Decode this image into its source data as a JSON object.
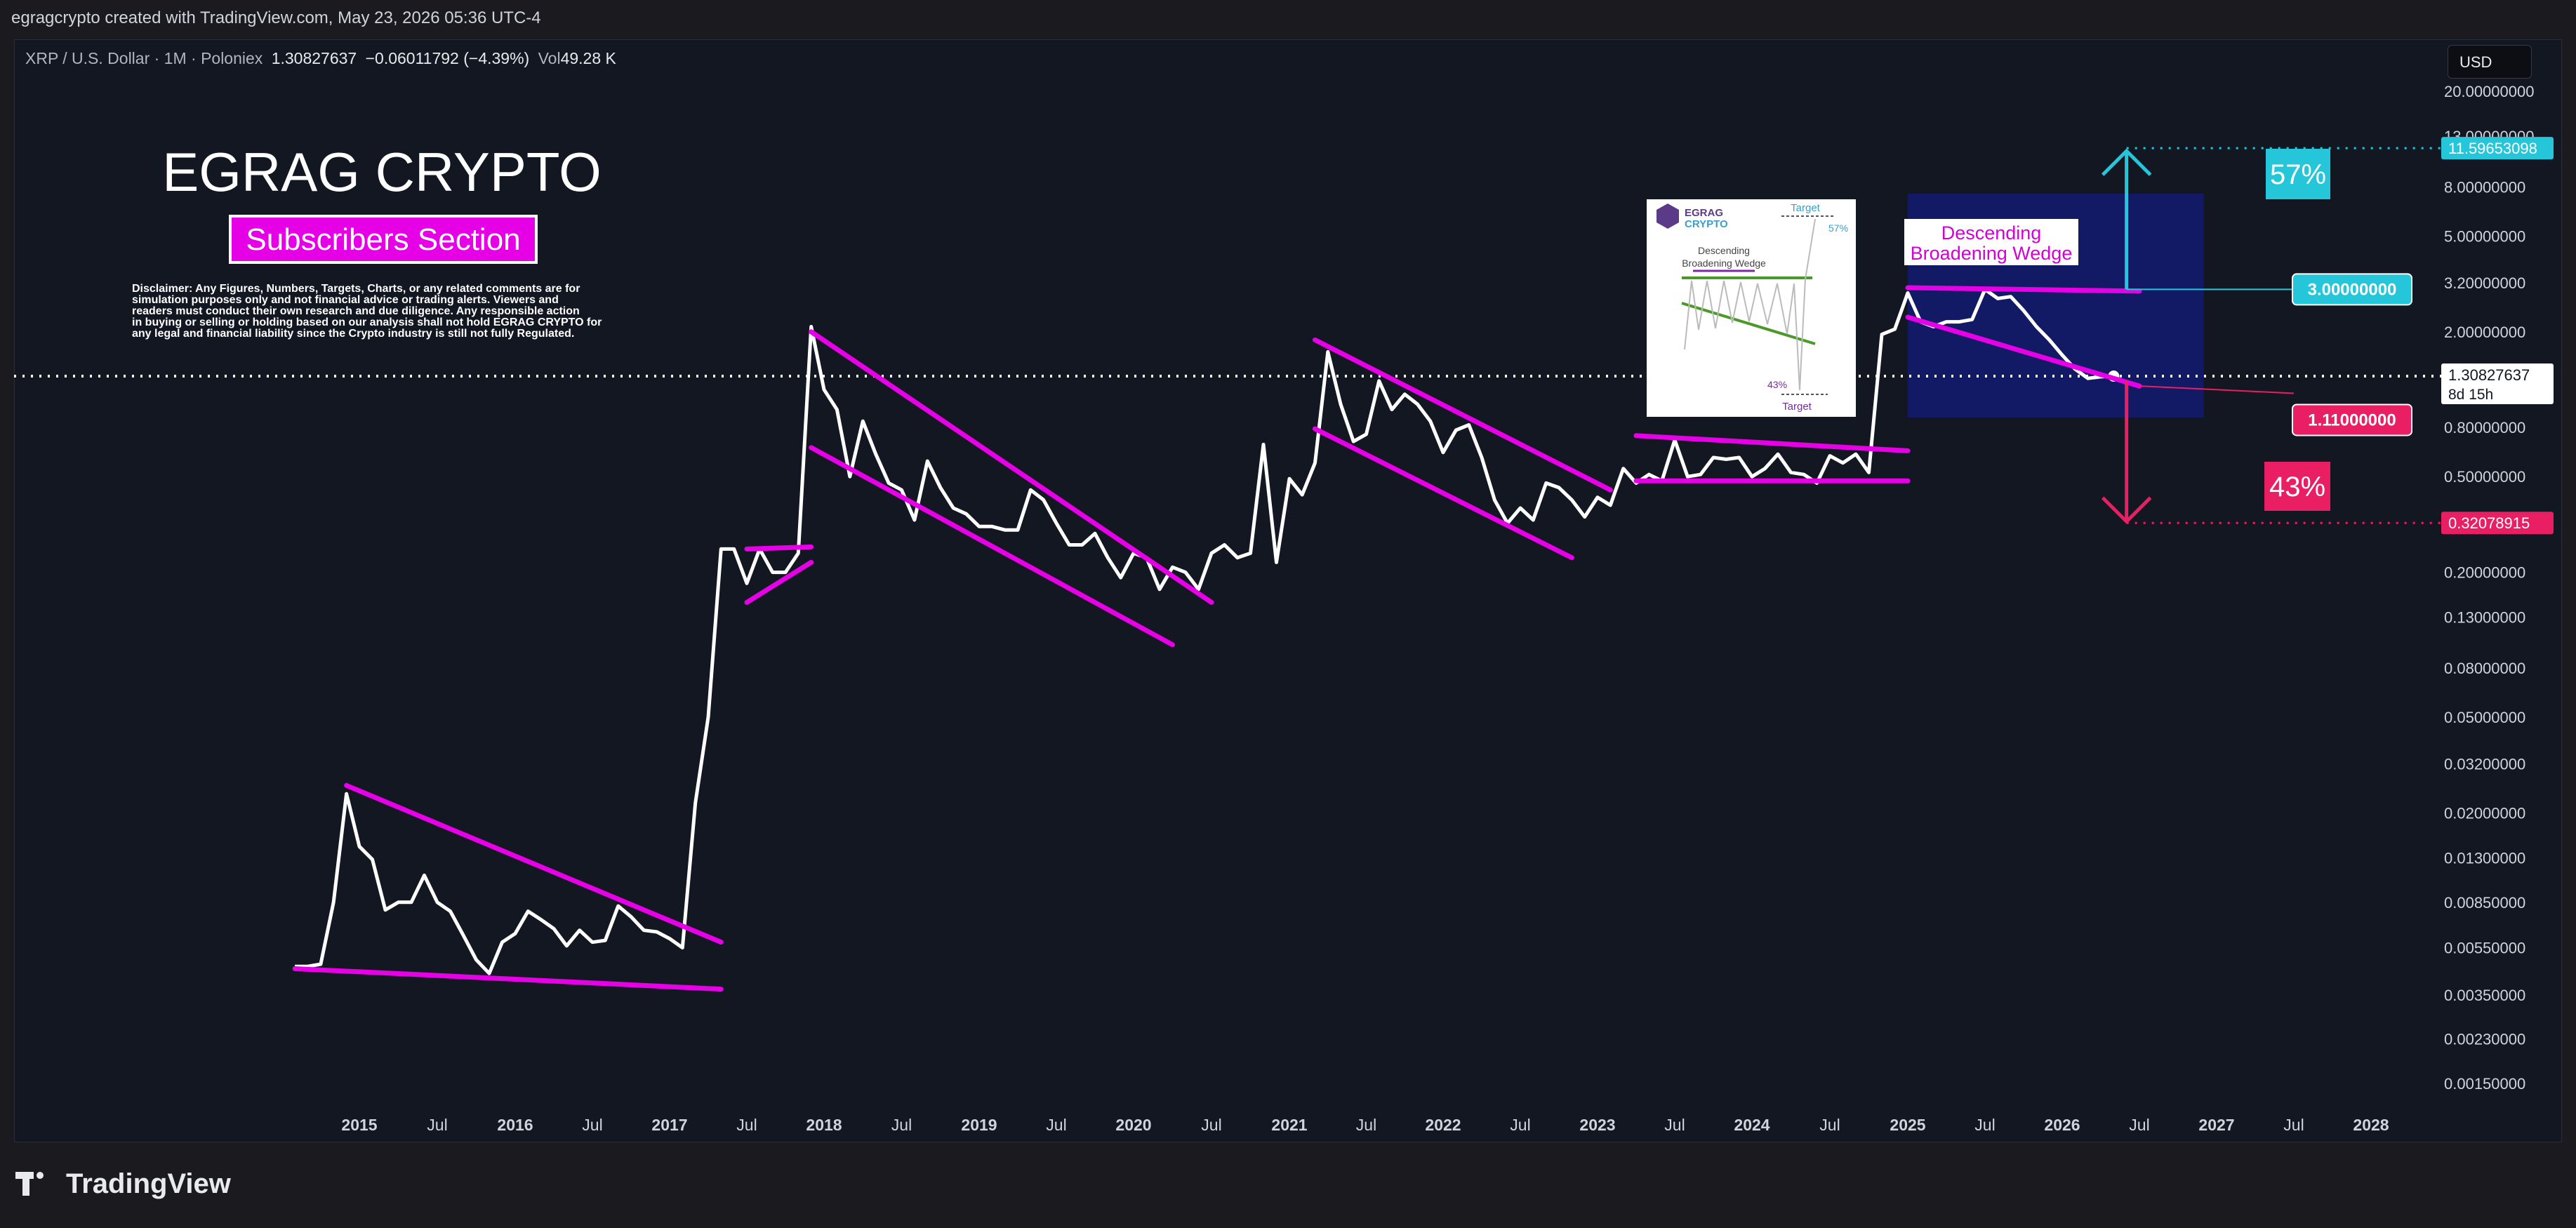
{
  "header": {
    "credit": "egragcrypto created with TradingView.com, May 23, 2026 05:36 UTC-4"
  },
  "legend": {
    "symbol": "XRP / U.S. Dollar · 1M · Poloniex",
    "price": "1.30827637",
    "change": "−0.06011792 (−4.39%)",
    "vol_label": "Vol",
    "vol": "49.28 K"
  },
  "currency_button": "USD",
  "brand": {
    "name": "TradingView"
  },
  "overlay": {
    "title": "EGRAG CRYPTO",
    "subscribers": "Subscribers Section",
    "disclaimer": [
      "Disclaimer: Any Figures, Numbers, Targets, Charts, or any related comments are for",
      "simulation purposes only and not financial advice or trading alerts. Viewers and",
      "readers must conduct their own research and due diligence. Any responsible action",
      "in buying or selling or holding based on our analysis shall not hold EGRAG CRYPTO for",
      "any legal and financial liability since the Crypto industry is still not fully Regulated."
    ],
    "wedge_label_1": "Descending",
    "wedge_label_2": "Broadening Wedge",
    "pct_up": "57%",
    "pct_down": "43%",
    "inset": {
      "brand_1": "EGRAG",
      "brand_2": "CRYPTO",
      "target_top": "Target",
      "pct_top": "57%",
      "label_1": "Descending",
      "label_2": "Broadening Wedge",
      "pct_bottom": "43%",
      "target_bottom": "Target"
    }
  },
  "price_labels": {
    "top_target": "11.59653098",
    "resistance": "3.00000000",
    "current": "1.30827637",
    "countdown": "8d 15h",
    "support": "1.11000000",
    "bottom_target": "0.32078915"
  },
  "colors": {
    "background": "#131722",
    "price_line": "#ffffff",
    "pattern": "#e600e6",
    "cyan": "#26c6da",
    "pink": "#e91e63",
    "box": "#121a6b"
  },
  "chart_data": {
    "type": "line",
    "title": "",
    "xlabel": "",
    "ylabel": "",
    "yscale": "log",
    "ylim": [
      0.0012,
      26
    ],
    "x_range": [
      "2014-03",
      "2028-12"
    ],
    "y_ticks": [
      "20.00000000",
      "13.00000000",
      "8.00000000",
      "5.00000000",
      "3.20000000",
      "2.00000000",
      "1.30000000",
      "0.80000000",
      "0.50000000",
      "0.32000000",
      "0.20000000",
      "0.13000000",
      "0.08000000",
      "0.05000000",
      "0.03200000",
      "0.02000000",
      "0.01300000",
      "0.00850000",
      "0.00550000",
      "0.00350000",
      "0.00230000",
      "0.00150000"
    ],
    "x_ticks": [
      {
        "label": "2015",
        "date": "2015-01",
        "major": true
      },
      {
        "label": "Jul",
        "date": "2015-07",
        "major": false
      },
      {
        "label": "2016",
        "date": "2016-01",
        "major": true
      },
      {
        "label": "Jul",
        "date": "2016-07",
        "major": false
      },
      {
        "label": "2017",
        "date": "2017-01",
        "major": true
      },
      {
        "label": "Jul",
        "date": "2017-07",
        "major": false
      },
      {
        "label": "2018",
        "date": "2018-01",
        "major": true
      },
      {
        "label": "Jul",
        "date": "2018-07",
        "major": false
      },
      {
        "label": "2019",
        "date": "2019-01",
        "major": true
      },
      {
        "label": "Jul",
        "date": "2019-07",
        "major": false
      },
      {
        "label": "2020",
        "date": "2020-01",
        "major": true
      },
      {
        "label": "Jul",
        "date": "2020-07",
        "major": false
      },
      {
        "label": "2021",
        "date": "2021-01",
        "major": true
      },
      {
        "label": "Jul",
        "date": "2021-07",
        "major": false
      },
      {
        "label": "2022",
        "date": "2022-01",
        "major": true
      },
      {
        "label": "Jul",
        "date": "2022-07",
        "major": false
      },
      {
        "label": "2023",
        "date": "2023-01",
        "major": true
      },
      {
        "label": "Jul",
        "date": "2023-07",
        "major": false
      },
      {
        "label": "2024",
        "date": "2024-01",
        "major": true
      },
      {
        "label": "Jul",
        "date": "2024-07",
        "major": false
      },
      {
        "label": "2025",
        "date": "2025-01",
        "major": true
      },
      {
        "label": "Jul",
        "date": "2025-07",
        "major": false
      },
      {
        "label": "2026",
        "date": "2026-01",
        "major": true
      },
      {
        "label": "Jul",
        "date": "2026-07",
        "major": false
      },
      {
        "label": "2027",
        "date": "2027-01",
        "major": true
      },
      {
        "label": "Jul",
        "date": "2027-07",
        "major": false
      },
      {
        "label": "2028",
        "date": "2028-01",
        "major": true
      }
    ],
    "series": [
      {
        "points": [
          [
            "2014-08",
            0.0046
          ],
          [
            "2014-09",
            0.0046
          ],
          [
            "2014-10",
            0.0047
          ],
          [
            "2014-11",
            0.0085
          ],
          [
            "2014-12",
            0.024
          ],
          [
            "2015-01",
            0.0145
          ],
          [
            "2015-02",
            0.0128
          ],
          [
            "2015-03",
            0.0079
          ],
          [
            "2015-04",
            0.0085
          ],
          [
            "2015-05",
            0.0085
          ],
          [
            "2015-06",
            0.011
          ],
          [
            "2015-07",
            0.0085
          ],
          [
            "2015-08",
            0.0078
          ],
          [
            "2015-09",
            0.0062
          ],
          [
            "2015-10",
            0.0049
          ],
          [
            "2015-11",
            0.0043
          ],
          [
            "2015-12",
            0.0058
          ],
          [
            "2016-01",
            0.0063
          ],
          [
            "2016-02",
            0.0078
          ],
          [
            "2016-03",
            0.0072
          ],
          [
            "2016-04",
            0.0066
          ],
          [
            "2016-05",
            0.0056
          ],
          [
            "2016-06",
            0.0065
          ],
          [
            "2016-07",
            0.0058
          ],
          [
            "2016-08",
            0.0059
          ],
          [
            "2016-09",
            0.0082
          ],
          [
            "2016-10",
            0.0074
          ],
          [
            "2016-11",
            0.0065
          ],
          [
            "2016-12",
            0.0064
          ],
          [
            "2017-01",
            0.006
          ],
          [
            "2017-02",
            0.0055
          ],
          [
            "2017-03",
            0.022
          ],
          [
            "2017-04",
            0.05
          ],
          [
            "2017-05",
            0.25
          ],
          [
            "2017-06",
            0.25
          ],
          [
            "2017-07",
            0.18
          ],
          [
            "2017-08",
            0.25
          ],
          [
            "2017-09",
            0.2
          ],
          [
            "2017-10",
            0.2
          ],
          [
            "2017-11",
            0.24
          ],
          [
            "2017-12",
            2.1
          ],
          [
            "2018-01",
            1.15
          ],
          [
            "2018-02",
            0.95
          ],
          [
            "2018-03",
            0.5
          ],
          [
            "2018-04",
            0.85
          ],
          [
            "2018-05",
            0.62
          ],
          [
            "2018-06",
            0.47
          ],
          [
            "2018-07",
            0.44
          ],
          [
            "2018-08",
            0.33
          ],
          [
            "2018-09",
            0.58
          ],
          [
            "2018-10",
            0.45
          ],
          [
            "2018-11",
            0.37
          ],
          [
            "2018-12",
            0.35
          ],
          [
            "2019-01",
            0.31
          ],
          [
            "2019-02",
            0.31
          ],
          [
            "2019-03",
            0.3
          ],
          [
            "2019-04",
            0.3
          ],
          [
            "2019-05",
            0.44
          ],
          [
            "2019-06",
            0.4
          ],
          [
            "2019-07",
            0.32
          ],
          [
            "2019-08",
            0.26
          ],
          [
            "2019-09",
            0.26
          ],
          [
            "2019-10",
            0.29
          ],
          [
            "2019-11",
            0.23
          ],
          [
            "2019-12",
            0.19
          ],
          [
            "2020-01",
            0.24
          ],
          [
            "2020-02",
            0.23
          ],
          [
            "2020-03",
            0.17
          ],
          [
            "2020-04",
            0.21
          ],
          [
            "2020-05",
            0.2
          ],
          [
            "2020-06",
            0.17
          ],
          [
            "2020-07",
            0.24
          ],
          [
            "2020-08",
            0.26
          ],
          [
            "2020-09",
            0.23
          ],
          [
            "2020-10",
            0.24
          ],
          [
            "2020-11",
            0.68
          ],
          [
            "2020-12",
            0.22
          ],
          [
            "2021-01",
            0.49
          ],
          [
            "2021-02",
            0.42
          ],
          [
            "2021-03",
            0.57
          ],
          [
            "2021-04",
            1.65
          ],
          [
            "2021-05",
            1.0
          ],
          [
            "2021-06",
            0.7
          ],
          [
            "2021-07",
            0.75
          ],
          [
            "2021-08",
            1.25
          ],
          [
            "2021-09",
            0.95
          ],
          [
            "2021-10",
            1.1
          ],
          [
            "2021-11",
            1.0
          ],
          [
            "2021-12",
            0.85
          ],
          [
            "2022-01",
            0.63
          ],
          [
            "2022-02",
            0.78
          ],
          [
            "2022-03",
            0.82
          ],
          [
            "2022-04",
            0.6
          ],
          [
            "2022-05",
            0.4
          ],
          [
            "2022-06",
            0.32
          ],
          [
            "2022-07",
            0.37
          ],
          [
            "2022-08",
            0.33
          ],
          [
            "2022-09",
            0.47
          ],
          [
            "2022-10",
            0.45
          ],
          [
            "2022-11",
            0.4
          ],
          [
            "2022-12",
            0.34
          ],
          [
            "2023-01",
            0.41
          ],
          [
            "2023-02",
            0.38
          ],
          [
            "2023-03",
            0.54
          ],
          [
            "2023-04",
            0.47
          ],
          [
            "2023-05",
            0.51
          ],
          [
            "2023-06",
            0.48
          ],
          [
            "2023-07",
            0.71
          ],
          [
            "2023-08",
            0.5
          ],
          [
            "2023-09",
            0.51
          ],
          [
            "2023-10",
            0.6
          ],
          [
            "2023-11",
            0.59
          ],
          [
            "2023-12",
            0.6
          ],
          [
            "2024-01",
            0.5
          ],
          [
            "2024-02",
            0.54
          ],
          [
            "2024-03",
            0.62
          ],
          [
            "2024-04",
            0.52
          ],
          [
            "2024-05",
            0.51
          ],
          [
            "2024-06",
            0.47
          ],
          [
            "2024-07",
            0.61
          ],
          [
            "2024-08",
            0.57
          ],
          [
            "2024-09",
            0.62
          ],
          [
            "2024-10",
            0.52
          ],
          [
            "2024-11",
            1.95
          ],
          [
            "2024-12",
            2.05
          ],
          [
            "2025-01",
            2.9
          ],
          [
            "2025-02",
            2.2
          ],
          [
            "2025-03",
            2.1
          ],
          [
            "2025-04",
            2.2
          ],
          [
            "2025-05",
            2.2
          ],
          [
            "2025-06",
            2.25
          ],
          [
            "2025-07",
            3.0
          ],
          [
            "2025-08",
            2.75
          ],
          [
            "2025-09",
            2.8
          ],
          [
            "2025-10",
            2.45
          ],
          [
            "2025-11",
            2.1
          ],
          [
            "2025-12",
            1.85
          ],
          [
            "2026-01",
            1.6
          ],
          [
            "2026-02",
            1.4
          ],
          [
            "2026-03",
            1.28
          ],
          [
            "2026-04",
            1.3
          ],
          [
            "2026-05",
            1.308
          ]
        ]
      }
    ],
    "annotations": {
      "trendlines": [
        [
          [
            "2014-08",
            0.0045
          ],
          [
            "2017-05",
            0.0037
          ]
        ],
        [
          [
            "2014-12",
            0.026
          ],
          [
            "2017-05",
            0.0058
          ]
        ],
        [
          [
            "2017-07",
            0.25
          ],
          [
            "2017-12",
            0.255
          ]
        ],
        [
          [
            "2017-07",
            0.15
          ],
          [
            "2017-12",
            0.22
          ]
        ],
        [
          [
            "2017-12",
            2.0
          ],
          [
            "2020-07",
            0.15
          ]
        ],
        [
          [
            "2017-12",
            0.66
          ],
          [
            "2020-04",
            0.1
          ]
        ],
        [
          [
            "2021-03",
            1.85
          ],
          [
            "2023-02",
            0.44
          ]
        ],
        [
          [
            "2021-03",
            0.79
          ],
          [
            "2022-11",
            0.23
          ]
        ],
        [
          [
            "2023-04",
            0.74
          ],
          [
            "2025-01",
            0.64
          ]
        ],
        [
          [
            "2023-04",
            0.48
          ],
          [
            "2025-01",
            0.48
          ]
        ],
        [
          [
            "2025-01",
            3.05
          ],
          [
            "2026-07",
            2.95
          ]
        ],
        [
          [
            "2025-01",
            2.3
          ],
          [
            "2026-07",
            1.19
          ]
        ]
      ],
      "box": {
        "x": [
          "2025-01",
          "2026-12"
        ],
        "y": [
          0.88,
          7.5
        ]
      },
      "target_up": 11.59653098,
      "target_down": 0.32078915
    }
  }
}
